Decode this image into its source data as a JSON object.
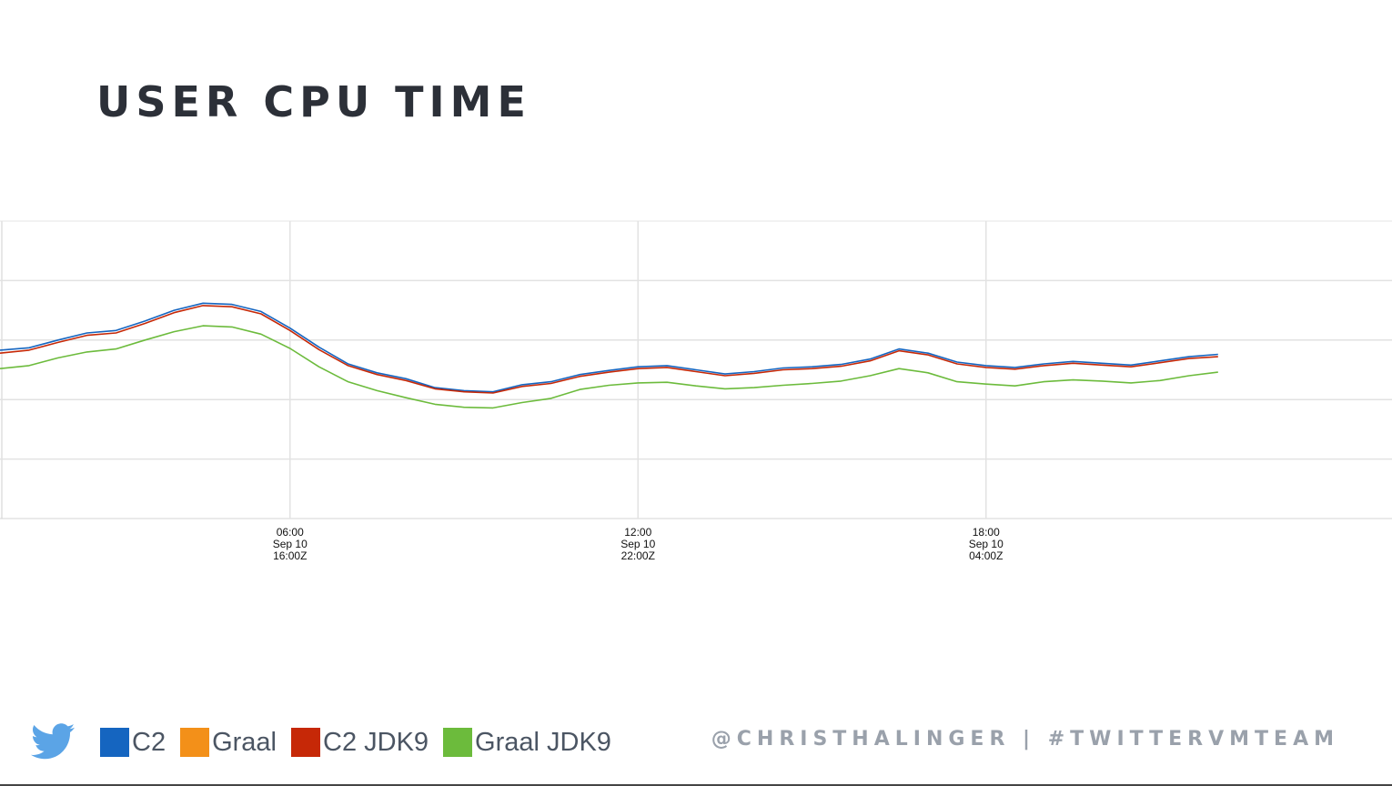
{
  "title": "USER CPU TIME",
  "footer": "@CHRISTHALINGER | #TWITTERVMTEAM",
  "icons": {
    "social": "twitter-bird-icon"
  },
  "colors": {
    "title": "#2c3038",
    "footer": "#9aa1ab",
    "twitter": "#5ba4e6"
  },
  "legend": [
    {
      "label": "C2",
      "color": "#1565c0"
    },
    {
      "label": "Graal",
      "color": "#f39019"
    },
    {
      "label": "C2 JDK9",
      "color": "#c62807"
    },
    {
      "label": "Graal JDK9",
      "color": "#6cbb3c"
    }
  ],
  "chart_data": {
    "type": "line",
    "title": "USER CPU TIME",
    "xlabel": "",
    "ylabel": "",
    "xlim": [
      1.0,
      25.0
    ],
    "ylim": [
      0,
      5
    ],
    "grid": true,
    "y_tick_values": [
      1,
      2,
      3,
      4
    ],
    "x_ticks": [
      {
        "value": 6,
        "lines": [
          "06:00",
          "Sep 10",
          "16:00Z"
        ]
      },
      {
        "value": 12,
        "lines": [
          "12:00",
          "Sep 10",
          "22:00Z"
        ]
      },
      {
        "value": 18,
        "lines": [
          "18:00",
          "Sep 10",
          "04:00Z"
        ]
      }
    ],
    "x": [
      1.0,
      1.5,
      2.0,
      2.5,
      3.0,
      3.5,
      4.0,
      4.5,
      5.0,
      5.5,
      6.0,
      6.5,
      7.0,
      7.5,
      8.0,
      8.5,
      9.0,
      9.5,
      10.0,
      10.5,
      11.0,
      11.5,
      12.0,
      12.5,
      13.0,
      13.5,
      14.0,
      14.5,
      15.0,
      15.5,
      16.0,
      16.5,
      17.0,
      17.5,
      18.0,
      18.5,
      19.0,
      19.5,
      20.0,
      20.5,
      21.0,
      21.5,
      22.0,
      22.5,
      23.0,
      23.5,
      24.0,
      24.5,
      25.0
    ],
    "series": [
      {
        "name": "C2",
        "color": "#1565c0",
        "values": [
          2.83,
          2.87,
          3.0,
          3.12,
          3.16,
          3.32,
          3.5,
          3.62,
          3.6,
          3.48,
          3.2,
          2.88,
          2.6,
          2.45,
          2.35,
          2.2,
          2.15,
          2.13,
          2.25,
          2.3,
          2.42,
          2.49,
          2.55,
          2.57,
          2.5,
          2.43,
          2.47,
          2.53,
          2.55,
          2.59,
          2.68,
          2.85,
          2.78,
          2.63,
          2.57,
          2.54,
          2.6,
          2.64,
          2.61,
          2.58,
          2.65,
          2.72,
          2.76
        ]
      },
      {
        "name": "Graal",
        "color": "#f39019",
        "values": []
      },
      {
        "name": "C2 JDK9",
        "color": "#c62807",
        "values": [
          2.78,
          2.83,
          2.96,
          3.08,
          3.12,
          3.28,
          3.46,
          3.58,
          3.56,
          3.44,
          3.16,
          2.84,
          2.57,
          2.42,
          2.32,
          2.18,
          2.13,
          2.11,
          2.22,
          2.27,
          2.39,
          2.46,
          2.52,
          2.54,
          2.47,
          2.4,
          2.44,
          2.5,
          2.52,
          2.56,
          2.65,
          2.82,
          2.75,
          2.6,
          2.54,
          2.51,
          2.57,
          2.61,
          2.58,
          2.55,
          2.62,
          2.69,
          2.72
        ]
      },
      {
        "name": "Graal JDK9",
        "color": "#6cbb3c",
        "values": [
          2.52,
          2.57,
          2.7,
          2.8,
          2.85,
          3.0,
          3.14,
          3.24,
          3.22,
          3.1,
          2.86,
          2.55,
          2.3,
          2.15,
          2.03,
          1.92,
          1.87,
          1.86,
          1.95,
          2.02,
          2.17,
          2.24,
          2.28,
          2.29,
          2.23,
          2.18,
          2.2,
          2.24,
          2.27,
          2.31,
          2.4,
          2.52,
          2.45,
          2.3,
          2.26,
          2.23,
          2.3,
          2.33,
          2.31,
          2.28,
          2.32,
          2.4,
          2.46
        ]
      }
    ]
  }
}
